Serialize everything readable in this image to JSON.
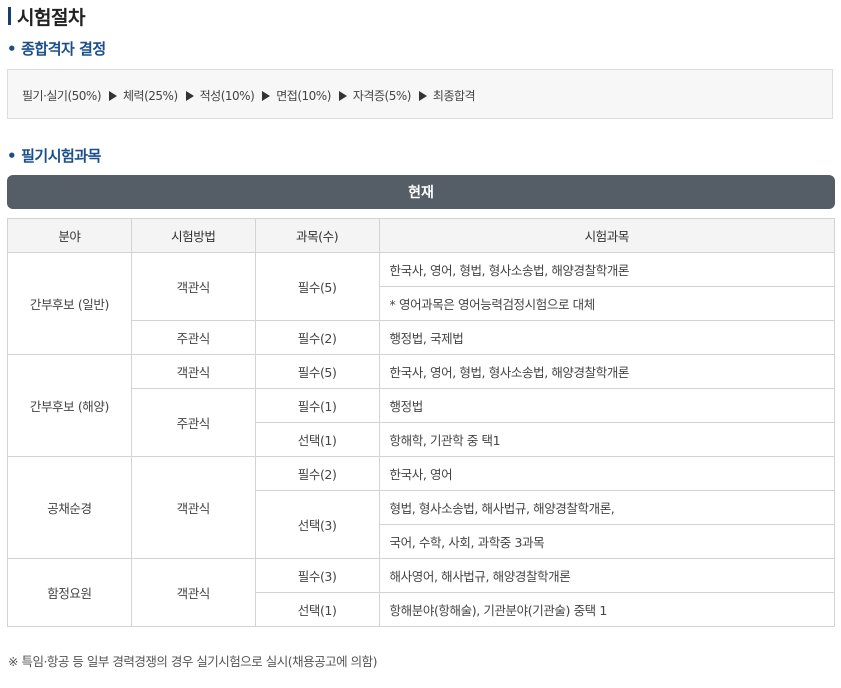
{
  "title": "시험절차",
  "sections": [
    {
      "bullet": "•",
      "label": "종합격자 결정"
    },
    {
      "bullet": "•",
      "label": "필기시험과목"
    }
  ],
  "flow": {
    "steps": [
      "필기·실기(50%)",
      "체력(25%)",
      "적성(10%)",
      "면접(10%)",
      "자격증(5%)",
      "최종합격"
    ]
  },
  "table_banner": "현재",
  "table": {
    "headers": [
      "분야",
      "시험방법",
      "과목(수)",
      "시험과목"
    ],
    "groups": [
      {
        "field": "간부후보 (일반)",
        "rows": [
          {
            "method": "객관식",
            "count": "필수(5)",
            "subjects": "한국사, 영어, 형법, 형사소송법, 해양경찰학개론"
          },
          {
            "subjects": "* 영어과목은 영어능력검정시험으로 대체"
          },
          {
            "method": "주관식",
            "count": "필수(2)",
            "subjects": "행정법, 국제법"
          }
        ]
      },
      {
        "field": "간부후보 (해양)",
        "rows": [
          {
            "method": "객관식",
            "count": "필수(5)",
            "subjects": "한국사, 영어, 형법, 형사소송법, 해양경찰학개론"
          },
          {
            "method": "주관식",
            "count": "필수(1)",
            "subjects": "행정법"
          },
          {
            "count": "선택(1)",
            "subjects": "항해학, 기관학 중 택1"
          }
        ]
      },
      {
        "field": "공채순경",
        "rows": [
          {
            "method": "객관식",
            "count": "필수(2)",
            "subjects": "한국사, 영어"
          },
          {
            "count": "선택(3)",
            "subjects": "형법, 형사소송법, 해사법규, 해양경찰학개론,"
          },
          {
            "subjects": "국어, 수학, 사회, 과학중 3과목"
          }
        ]
      },
      {
        "field": "함정요원",
        "rows": [
          {
            "method": "객관식",
            "count": "필수(3)",
            "subjects": "해사영어, 해사법규, 해양경찰학개론"
          },
          {
            "count": "선택(1)",
            "subjects": "항해분야(항해술), 기관분야(기관술) 중택 1"
          }
        ]
      }
    ]
  },
  "footnote": "※ 특임·항공 등 일부 경력경쟁의 경우 실기시험으로 실시(채용공고에 의함)"
}
